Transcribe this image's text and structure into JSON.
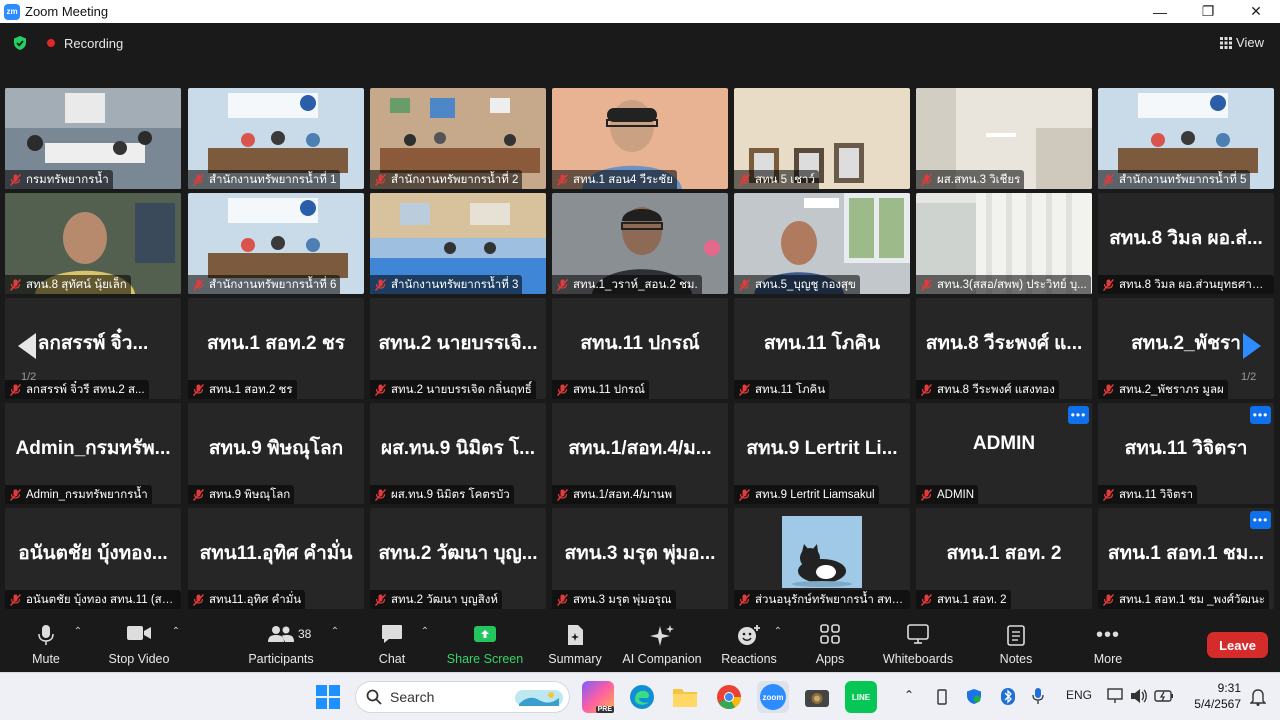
{
  "window": {
    "title": "Zoom Meeting",
    "logo_text": "zm"
  },
  "topbar": {
    "recording_label": "Recording",
    "view_label": "View"
  },
  "pagination": {
    "left": "1/2",
    "right": "1/2"
  },
  "tiles": [
    {
      "label": "กรมทรัพยากรน้ำ",
      "active": true,
      "video": "room"
    },
    {
      "label": "สำนักงานทรัพยากรน้ำที่ 1",
      "video": "office"
    },
    {
      "label": "สำนักงานทรัพยากรน้ำที่ 2",
      "video": "conf"
    },
    {
      "label": "สทน.1 สอน4 วีระชัย",
      "video": "person_orange"
    },
    {
      "label": "สทน 5 เชาว์",
      "video": "wall"
    },
    {
      "label": "ผส.สทน.3 วิเชียร",
      "video": "ceiling"
    },
    {
      "label": "สำนักงานทรัพยากรน้ำที่ 5",
      "video": "office"
    },
    {
      "label": "สทน.8 สุทัศน์ นุ้ยเล็ก",
      "video": "person_blur"
    },
    {
      "label": "สำนักงานทรัพยากรน้ำที่ 6",
      "video": "office"
    },
    {
      "label": "สำนักงานทรัพยากรน้ำที่ 3",
      "video": "conf_blue"
    },
    {
      "label": "สทน.1_วราห์_สอน.2 ชม.",
      "video": "person_dark"
    },
    {
      "label": "สทน.5_บุญชู กองสุข",
      "video": "person_window"
    },
    {
      "label": "สทน.3(สสอ/สพพ) ประวิทย์ บุ...",
      "video": "curtain"
    },
    {
      "big": "สทน.8 วิมล ผอ.ส่...",
      "label": "สทน.8 วิมล ผอ.ส่วนยุทธศาสตร์"
    },
    {
      "big": "ลกสรรพ์ จิ๋ว...",
      "label": "ลกสรรพ์ จิ๋วรี สทน.2 ส..."
    },
    {
      "big": "สทน.1 สอท.2 ชร",
      "label": "สทน.1 สอท.2 ชร"
    },
    {
      "big": "สทน.2 นายบรรเจิ...",
      "label": "สทน.2 นายบรรเจิด กลิ่นฤทธิ์"
    },
    {
      "big": "สทน.11 ปกรณ์",
      "label": "สทน.11 ปกรณ์"
    },
    {
      "big": "สทน.11 โภคิน",
      "label": "สทน.11 โภคิน"
    },
    {
      "big": "สทน.8 วีระพงศ์ แ...",
      "label": "สทน.8 วีระพงศ์ แสงทอง"
    },
    {
      "big": "สทน.2_พัชรา",
      "label": "สทน.2_พัชราภร มูลผ"
    },
    {
      "big": "Admin_กรมทรัพ...",
      "label": "Admin_กรมทรัพยากรน้ำ"
    },
    {
      "big": "สทน.9 พิษณุโลก",
      "label": "สทน.9 พิษณุโลก"
    },
    {
      "big": "ผส.ทน.9 นิมิตร โ...",
      "label": "ผส.ทน.9 นิมิตร โคตรบัว"
    },
    {
      "big": "สทน.1/สอท.4/ม...",
      "label": "สทน.1/สอท.4/มานพ"
    },
    {
      "big": "สทน.9 Lertrit Li...",
      "label": "สทน.9 Lertrit Liamsakul"
    },
    {
      "big": "ADMIN",
      "label": "ADMIN",
      "more": true
    },
    {
      "big": "สทน.11 วิจิตรา",
      "label": "สทน.11 วิจิตรา",
      "more": true
    },
    {
      "big": "อนันตชัย บุ้งทอง...",
      "label": "อนันตชัย บุ้งทอง สทน.11 (สบร.)"
    },
    {
      "big": "สทน11.อุทิศ คำมั่น",
      "label": "สทน11.อุทิศ คำมั่น"
    },
    {
      "big": "สทน.2 วัฒนา บุญ...",
      "label": "สทน.2 วัฒนา บุญสิงห์"
    },
    {
      "big": "สทน.3 มรุต พุ่มอ...",
      "label": "สทน.3 มรุต พุ่มอรุณ"
    },
    {
      "avatar": true,
      "label": "ส่วนอนุรักษ์ทรัพยากรน้ำ สทน...."
    },
    {
      "big": "สทน.1 สอท. 2",
      "label": "สทน.1 สอท. 2"
    },
    {
      "big": "สทน.1 สอท.1 ชม...",
      "label": "สทน.1 สอท.1 ชม _พงศ์วัฒนะ",
      "more": true
    }
  ],
  "toolbar": {
    "mute": "Mute",
    "stop_video": "Stop Video",
    "participants": "Participants",
    "participants_count": "38",
    "chat": "Chat",
    "share_screen": "Share Screen",
    "summary": "Summary",
    "ai_companion": "AI Companion",
    "reactions": "Reactions",
    "apps": "Apps",
    "whiteboards": "Whiteboards",
    "notes": "Notes",
    "more": "More",
    "leave": "Leave"
  },
  "taskbar": {
    "search_placeholder": "Search",
    "copilot_badge": "PRE",
    "zoom_label": "zoom",
    "line_label": "LINE",
    "lang": "ENG",
    "time": "9:31",
    "date": "5/4/2567"
  },
  "colors": {
    "accent": "#2d8cff",
    "leave": "#d62b2b",
    "share_green": "#22c55e",
    "active_outline": "#e3e87a",
    "more_blue": "#0e71eb"
  }
}
